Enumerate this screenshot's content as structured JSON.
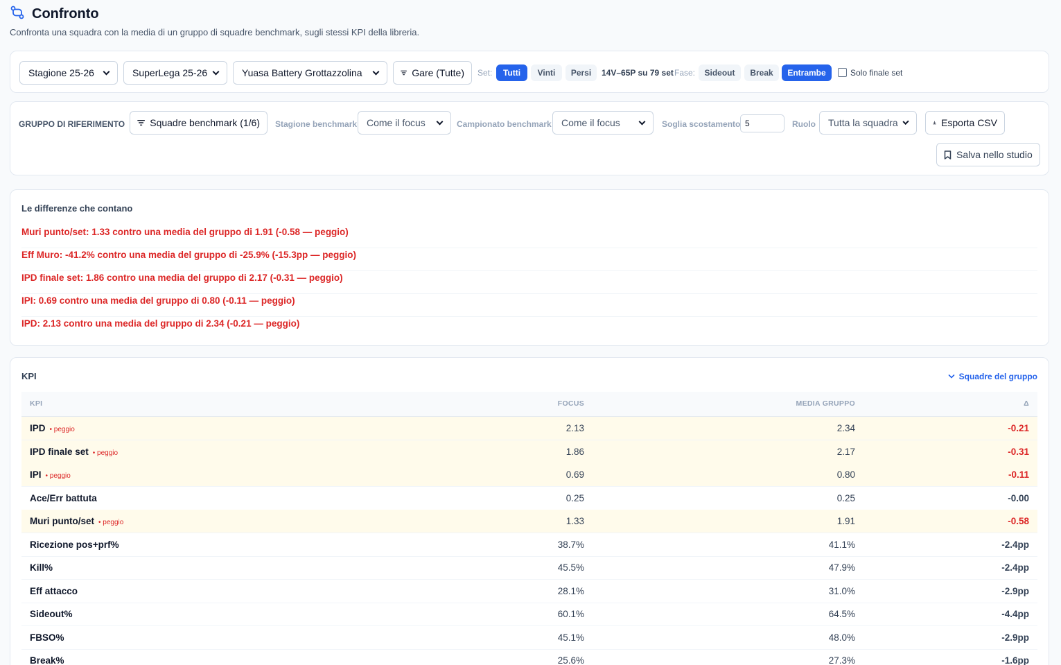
{
  "header": {
    "title": "Confronto",
    "subtitle": "Confronta una squadra con la media di un gruppo di squadre benchmark, sugli stessi KPI della libreria."
  },
  "filters": {
    "season": "Stagione 25-26",
    "league": "SuperLega 25-26",
    "team": "Yuasa Battery Grottazzolina",
    "matches_button": "Gare (Tutte)",
    "set_label": "Set:",
    "set_options": [
      "Tutti",
      "Vinti",
      "Persi"
    ],
    "set_selected": "Tutti",
    "record": "14V–65P su 79 set",
    "phase_label": "Fase:",
    "phase_options": [
      "Sideout",
      "Break",
      "Entrambe"
    ],
    "phase_selected": "Entrambe",
    "final_set_label": "Solo finale set"
  },
  "benchmark": {
    "group_label": "GRUPPO DI RIFERIMENTO",
    "teams_button": "Squadre benchmark (1/6)",
    "season_label": "Stagione benchmark",
    "season_value": "Come il focus",
    "league_label": "Campionato benchmark",
    "league_value": "Come il focus",
    "threshold_label": "Soglia scostamento",
    "threshold_value": "5",
    "role_label": "Ruolo",
    "role_value": "Tutta la squadra",
    "export_button": "Esporta CSV",
    "save_button": "Salva nello studio"
  },
  "differences": {
    "title": "Le differenze che contano",
    "items": [
      "Muri punto/set: 1.33 contro una media del gruppo di 1.91 (-0.58 — peggio)",
      "Eff Muro: -41.2% contro una media del gruppo di -25.9% (-15.3pp — peggio)",
      "IPD finale set: 1.86 contro una media del gruppo di 2.17 (-0.31 — peggio)",
      "IPI: 0.69 contro una media del gruppo di 0.80 (-0.11 — peggio)",
      "IPD: 2.13 contro una media del gruppo di 2.34 (-0.21 — peggio)"
    ]
  },
  "kpi": {
    "title": "KPI",
    "group_toggle": "Squadre del gruppo",
    "columns": {
      "kpi": "KPI",
      "focus": "FOCUS",
      "group": "MEDIA GRUPPO",
      "delta": "Δ"
    },
    "worse_tag": "• peggio",
    "rows": [
      {
        "name": "IPD",
        "focus": "2.13",
        "group": "2.34",
        "delta": "-0.21",
        "worse": "• peggio"
      },
      {
        "name": "IPD finale set",
        "focus": "1.86",
        "group": "2.17",
        "delta": "-0.31",
        "worse": "• peggio"
      },
      {
        "name": "IPI",
        "focus": "0.69",
        "group": "0.80",
        "delta": "-0.11",
        "worse": "• peggio"
      },
      {
        "name": "Ace/Err battuta",
        "focus": "0.25",
        "group": "0.25",
        "delta": "-0.00",
        "worse": ""
      },
      {
        "name": "Muri punto/set",
        "focus": "1.33",
        "group": "1.91",
        "delta": "-0.58",
        "worse": "• peggio"
      },
      {
        "name": "Ricezione pos+prf%",
        "focus": "38.7%",
        "group": "41.1%",
        "delta": "-2.4pp",
        "worse": ""
      },
      {
        "name": "Kill%",
        "focus": "45.5%",
        "group": "47.9%",
        "delta": "-2.4pp",
        "worse": ""
      },
      {
        "name": "Eff attacco",
        "focus": "28.1%",
        "group": "31.0%",
        "delta": "-2.9pp",
        "worse": ""
      },
      {
        "name": "Sideout%",
        "focus": "60.1%",
        "group": "64.5%",
        "delta": "-4.4pp",
        "worse": ""
      },
      {
        "name": "FBSO%",
        "focus": "45.1%",
        "group": "48.0%",
        "delta": "-2.9pp",
        "worse": ""
      },
      {
        "name": "Break%",
        "focus": "25.6%",
        "group": "27.3%",
        "delta": "-1.6pp",
        "worse": ""
      }
    ]
  },
  "colors": {
    "accent": "#2563eb",
    "bad": "#dc2626",
    "warn_row": "#fffbeb"
  }
}
